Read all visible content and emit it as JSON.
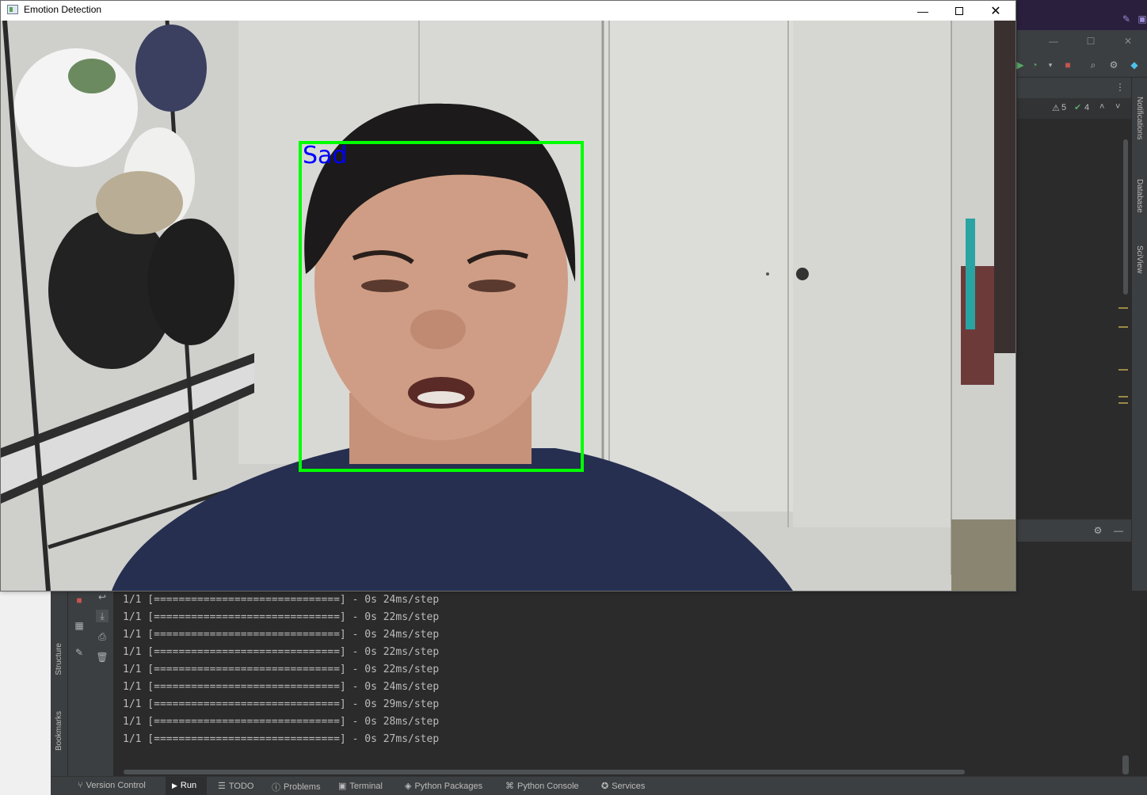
{
  "window": {
    "title": "Emotion Detection",
    "minimize_icon": "minimize-icon",
    "maximize_icon": "maximize-icon",
    "close_icon": "close-icon"
  },
  "camera": {
    "detection": {
      "label": "Sad",
      "box_color": "#00ff00",
      "label_color": "#0000ff"
    }
  },
  "ide": {
    "inspections": {
      "warnings": "5",
      "ok": "4"
    },
    "right_tool_windows": [
      "Notifications",
      "Database",
      "SciView"
    ],
    "left_tool_windows": [
      "Structure",
      "Bookmarks"
    ],
    "console_lines": [
      "1/1 [==============================] - 0s 24ms/step",
      "1/1 [==============================] - 0s 22ms/step",
      "1/1 [==============================] - 0s 24ms/step",
      "1/1 [==============================] - 0s 22ms/step",
      "1/1 [==============================] - 0s 22ms/step",
      "1/1 [==============================] - 0s 24ms/step",
      "1/1 [==============================] - 0s 29ms/step",
      "1/1 [==============================] - 0s 28ms/step",
      "1/1 [==============================] - 0s 27ms/step"
    ],
    "bottom_tabs": [
      {
        "label": "Version Control",
        "icon": "branch-icon"
      },
      {
        "label": "Run",
        "icon": "run-icon",
        "active": true
      },
      {
        "label": "TODO",
        "icon": "list-icon"
      },
      {
        "label": "Problems",
        "icon": "info-icon"
      },
      {
        "label": "Terminal",
        "icon": "terminal-icon"
      },
      {
        "label": "Python Packages",
        "icon": "layers-icon"
      },
      {
        "label": "Python Console",
        "icon": "python-icon"
      },
      {
        "label": "Services",
        "icon": "services-icon"
      }
    ],
    "colors": {
      "background": "#2b2b2b",
      "panel": "#3c3f41",
      "text": "#bbbbbb"
    }
  }
}
